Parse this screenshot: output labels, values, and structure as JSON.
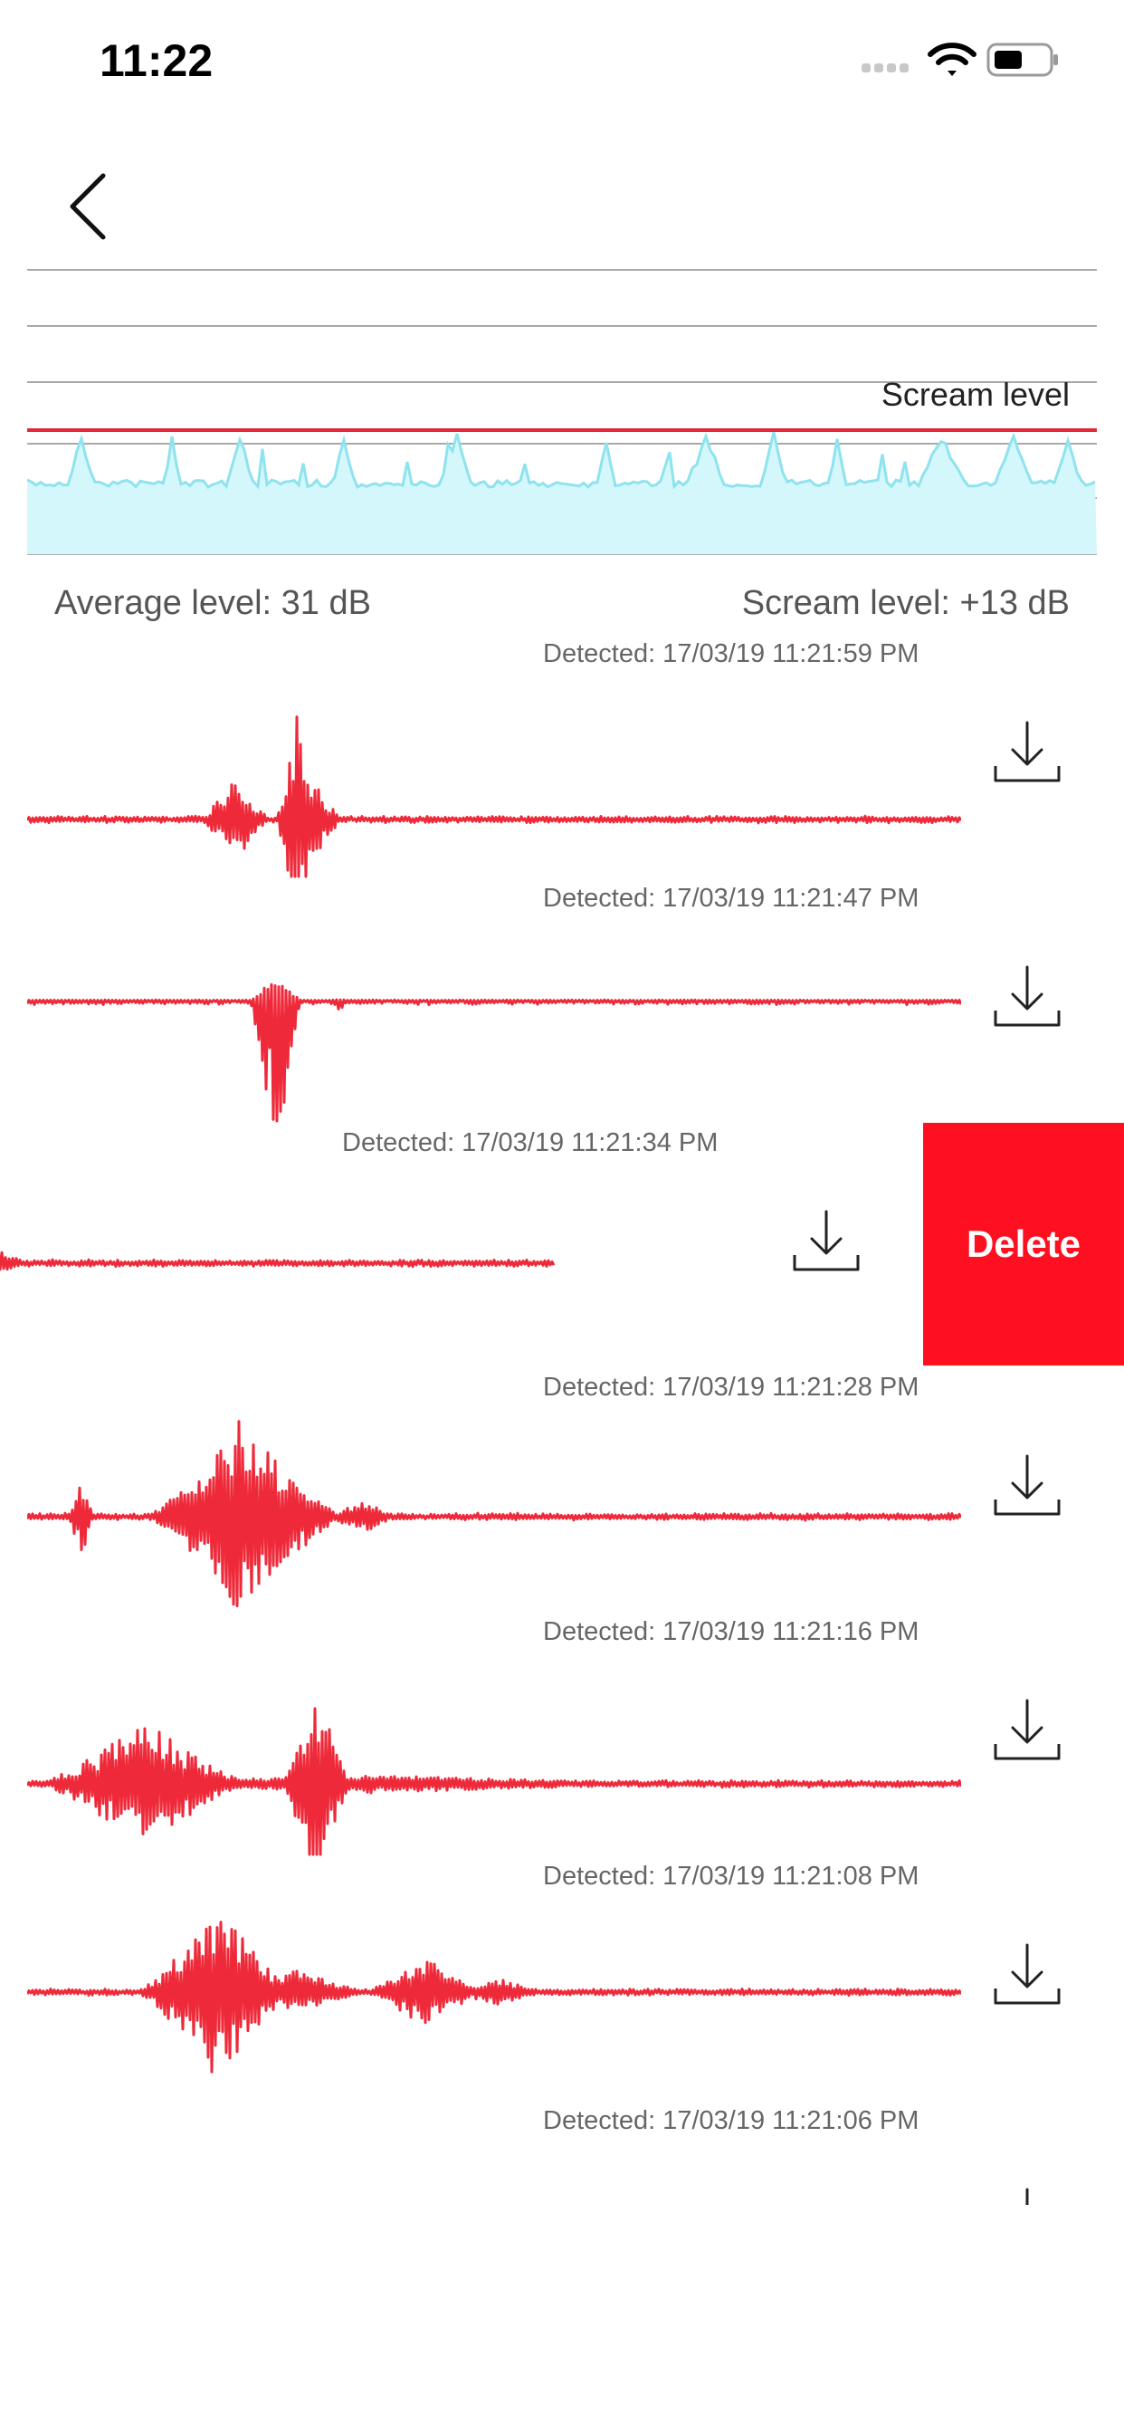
{
  "status_bar": {
    "time": "11:22"
  },
  "navigation": {
    "back_icon": "chevron-left-icon"
  },
  "level_chart": {
    "scream_level_label": "Scream level",
    "colors": {
      "fill": "#d3f7fb",
      "line": "#8fe3ee",
      "threshold": "#e02838",
      "grid": "#a8a8a8"
    }
  },
  "summary": {
    "average_level": "Average level: 31 dB",
    "scream_level": "Scream level: +13 dB"
  },
  "recordings": [
    {
      "detected": "Detected: 17/03/19 11:21:59 PM",
      "download_icon": "download-icon"
    },
    {
      "detected": "Detected: 17/03/19 11:21:47 PM",
      "download_icon": "download-icon"
    },
    {
      "detected": "Detected: 17/03/19 11:21:34 PM",
      "download_icon": "download-icon",
      "delete_label": "Delete"
    },
    {
      "detected": "Detected: 17/03/19 11:21:28 PM",
      "download_icon": "download-icon"
    },
    {
      "detected": "Detected: 17/03/19 11:21:16 PM",
      "download_icon": "download-icon"
    },
    {
      "detected": "Detected: 17/03/19 11:21:08 PM",
      "download_icon": "download-icon"
    },
    {
      "detected": "Detected: 17/03/19 11:21:06 PM",
      "download_icon": "download-icon"
    }
  ],
  "colors": {
    "waveform": "#ee2a3a",
    "delete": "#ff1020"
  }
}
